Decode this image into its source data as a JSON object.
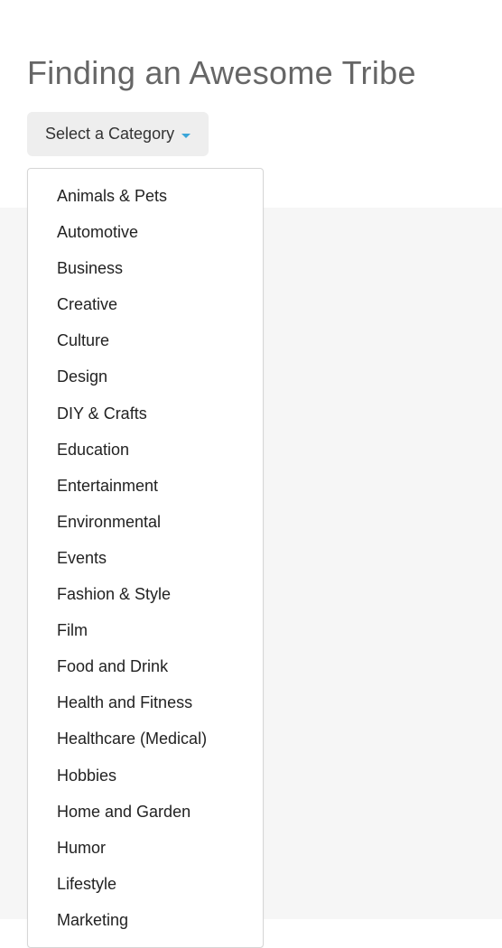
{
  "page": {
    "title": "Finding an Awesome Tribe"
  },
  "dropdown": {
    "button_label": "Select a Category",
    "options": [
      "Animals & Pets",
      "Automotive",
      "Business",
      "Creative",
      "Culture",
      "Design",
      "DIY & Crafts",
      "Education",
      "Entertainment",
      "Environmental",
      "Events",
      "Fashion & Style",
      "Film",
      "Food and Drink",
      "Health and Fitness",
      "Healthcare (Medical)",
      "Hobbies",
      "Home and Garden",
      "Humor",
      "Lifestyle",
      "Marketing"
    ]
  }
}
